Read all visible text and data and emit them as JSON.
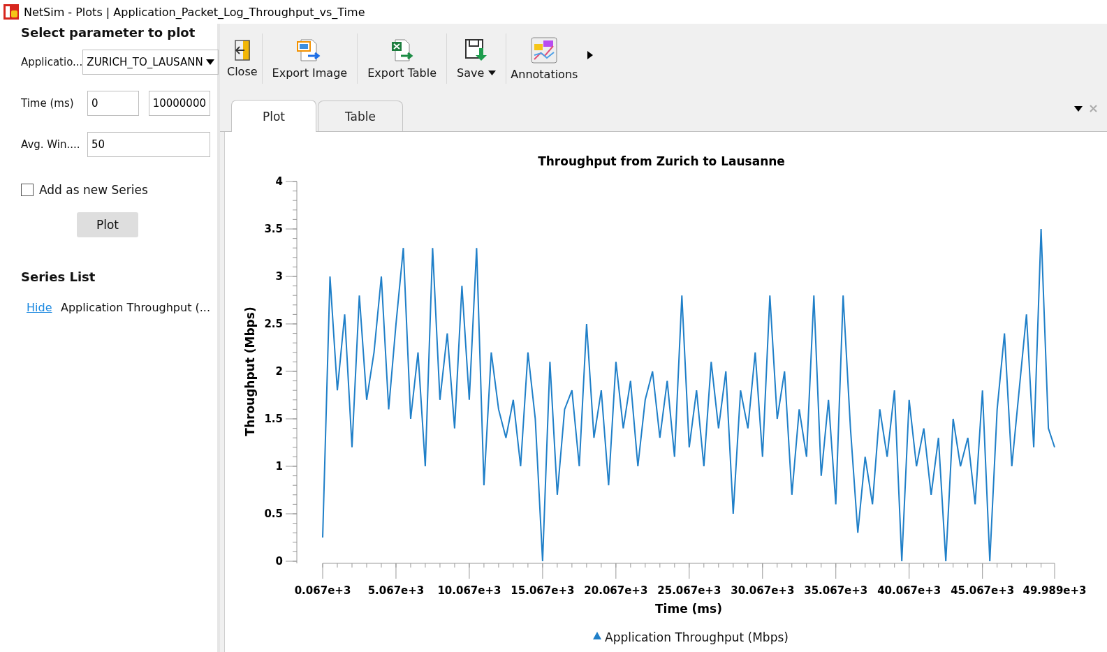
{
  "window": {
    "title": "NetSim - Plots | Application_Packet_Log_Throughput_vs_Time"
  },
  "left_panel": {
    "heading": "Select parameter to plot",
    "fields": [
      {
        "kind": "select",
        "label": "Applicatio...",
        "value": "ZURICH_TO_LAUSANN"
      },
      {
        "kind": "range",
        "label": "Time (ms)",
        "values": [
          "0",
          "10000000"
        ]
      },
      {
        "kind": "text",
        "label": "Avg. Win....",
        "value": "50"
      }
    ],
    "checkbox": {
      "label": "Add as new Series",
      "checked": false
    },
    "plot_button": "Plot",
    "series_list": {
      "heading": "Series List",
      "items": [
        {
          "link": "Hide",
          "name": "Application Throughput (..."
        }
      ]
    }
  },
  "toolbar": [
    {
      "kind": "close",
      "label": "Close",
      "has_menu": false
    },
    {
      "kind": "image",
      "label": "Export Image",
      "has_menu": false
    },
    {
      "kind": "table",
      "label": "Export Table",
      "has_menu": false
    },
    {
      "kind": "save",
      "label": "Save",
      "has_menu": true
    },
    {
      "kind": "annotations",
      "label": "Annotations",
      "has_menu": false
    }
  ],
  "tabs": [
    {
      "label": "Plot",
      "selected": true
    },
    {
      "label": "Table",
      "selected": false
    }
  ],
  "plot": {
    "chart_data": {
      "type": "line",
      "title": "Throughput from Zurich to Lausanne",
      "xlabel": "Time (ms)",
      "ylabel": "Throughput (Mbps)",
      "x": [
        67,
        567,
        1067,
        1567,
        2067,
        2567,
        3067,
        3567,
        4067,
        4567,
        5067,
        5567,
        6067,
        6567,
        7067,
        7567,
        8067,
        8567,
        9067,
        9567,
        10067,
        10567,
        11067,
        11567,
        12067,
        12567,
        13067,
        13567,
        14067,
        14567,
        15067,
        15567,
        16067,
        16567,
        17067,
        17567,
        18067,
        18567,
        19067,
        19567,
        20067,
        20567,
        21067,
        21567,
        22067,
        22567,
        23067,
        23567,
        24067,
        24567,
        25067,
        25567,
        26067,
        26567,
        27067,
        27567,
        28067,
        28567,
        29067,
        29567,
        30067,
        30567,
        31067,
        31567,
        32067,
        32567,
        33067,
        33567,
        34067,
        34567,
        35067,
        35567,
        36067,
        36567,
        37067,
        37567,
        38067,
        38567,
        39067,
        39567,
        40067,
        40567,
        41067,
        41567,
        42067,
        42567,
        43067,
        43567,
        44067,
        44567,
        45067,
        45567,
        46067,
        46567,
        47067,
        47567,
        48067,
        48567,
        49067,
        49567,
        49989
      ],
      "series": [
        {
          "name": "Application Throughput (Mbps)",
          "color": "#1f7fc8",
          "values": [
            0.25,
            3.0,
            1.8,
            2.6,
            1.2,
            2.8,
            1.7,
            2.2,
            3.0,
            1.6,
            2.5,
            3.3,
            1.5,
            2.2,
            1.0,
            3.3,
            1.7,
            2.4,
            1.4,
            2.9,
            1.7,
            3.3,
            0.8,
            2.2,
            1.6,
            1.3,
            1.7,
            1.0,
            2.2,
            1.5,
            0.0,
            2.1,
            0.7,
            1.6,
            1.8,
            1.0,
            2.5,
            1.3,
            1.8,
            0.8,
            2.1,
            1.4,
            1.9,
            1.0,
            1.7,
            2.0,
            1.3,
            1.9,
            1.1,
            2.8,
            1.2,
            1.8,
            1.0,
            2.1,
            1.4,
            2.0,
            0.5,
            1.8,
            1.4,
            2.2,
            1.1,
            2.8,
            1.5,
            2.0,
            0.7,
            1.6,
            1.1,
            2.8,
            0.9,
            1.7,
            0.6,
            2.8,
            1.4,
            0.3,
            1.1,
            0.6,
            1.6,
            1.1,
            1.8,
            0.0,
            1.7,
            1.0,
            1.4,
            0.7,
            1.3,
            0.0,
            1.5,
            1.0,
            1.3,
            0.6,
            1.8,
            0.0,
            1.6,
            2.4,
            1.0,
            1.8,
            2.6,
            1.2,
            3.5,
            1.4,
            1.2
          ]
        }
      ],
      "xlim": [
        67,
        49989
      ],
      "ylim": [
        0,
        4
      ],
      "xticks": [
        {
          "value": 67,
          "label": "0.067e+3"
        },
        {
          "value": 5067,
          "label": "5.067e+3"
        },
        {
          "value": 10067,
          "label": "10.067e+3"
        },
        {
          "value": 15067,
          "label": "15.067e+3"
        },
        {
          "value": 20067,
          "label": "20.067e+3"
        },
        {
          "value": 25067,
          "label": "25.067e+3"
        },
        {
          "value": 30067,
          "label": "30.067e+3"
        },
        {
          "value": 35067,
          "label": "35.067e+3"
        },
        {
          "value": 40067,
          "label": "40.067e+3"
        },
        {
          "value": 45067,
          "label": "45.067e+3"
        },
        {
          "value": 49989,
          "label": "49.989e+3"
        }
      ],
      "yticks": [
        0,
        0.5,
        1,
        1.5,
        2,
        2.5,
        3,
        3.5,
        4
      ]
    }
  }
}
